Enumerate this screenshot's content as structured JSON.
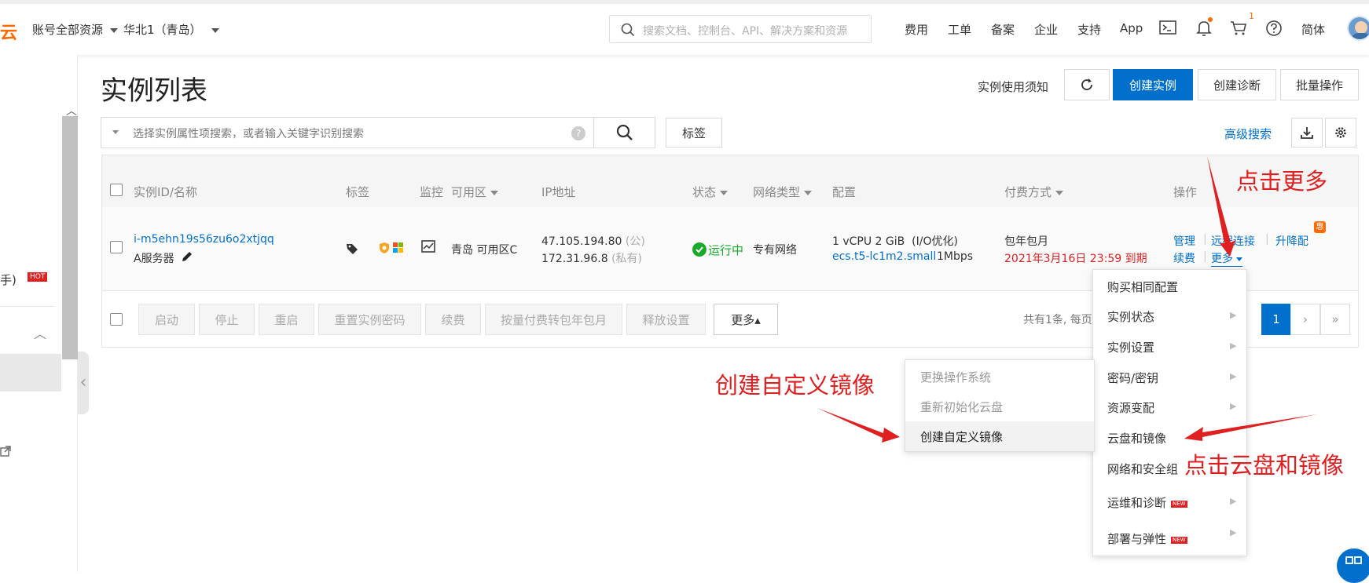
{
  "topbar": {
    "brand": "云",
    "account_scope": "账号全部资源",
    "region": "华北1（青岛）",
    "search_placeholder": "搜索文档、控制台、API、解决方案和资源",
    "nav": [
      "费用",
      "工单",
      "备案",
      "企业",
      "支持",
      "App"
    ],
    "cart_count": "1",
    "language": "简体"
  },
  "sidebar": {
    "partial_label": "手)",
    "hot_badge": "HOT"
  },
  "page": {
    "title": "实例列表",
    "usage_notice": "实例使用须知",
    "create_instance": "创建实例",
    "create_diagnosis": "创建诊断",
    "batch_ops": "批量操作",
    "filter_placeholder": "选择实例属性项搜索，或者输入关键字识别搜索",
    "tag_button": "标签",
    "advanced_search": "高级搜索"
  },
  "table": {
    "headers": {
      "id_name": "实例ID/名称",
      "tags": "标签",
      "monitor": "监控",
      "zone": "可用区",
      "ip": "IP地址",
      "status": "状态",
      "network_type": "网络类型",
      "config": "配置",
      "billing": "付费方式",
      "actions": "操作"
    },
    "row": {
      "id": "i-m5ehn19s56zu6o2xtjqq",
      "name": "A服务器",
      "zone": "青岛 可用区C",
      "public_ip": "47.105.194.80",
      "public_tag": "(公)",
      "private_ip": "172.31.96.8",
      "private_tag": "(私有)",
      "status": "运行中",
      "network": "专有网络",
      "config_line1": "1 vCPU 2 GiB",
      "config_io": "(I/O优化)",
      "instance_type": "ecs.t5-lc1m2.small",
      "bandwidth": "1Mbps",
      "billing": "包年包月",
      "expiry": "2021年3月16日 23:59 到期",
      "actions": {
        "manage": "管理",
        "remote_connect": "远程连接",
        "upgrade": "升降配",
        "renew": "续费",
        "more": "更多",
        "promo_badge": "惠"
      }
    }
  },
  "bulk_actions": [
    "启动",
    "停止",
    "重启",
    "重置实例密码",
    "续费",
    "按量付费转包年包月",
    "释放设置"
  ],
  "bulk_more": "更多▴",
  "pagination": {
    "summary": "共有1条, 每页",
    "current": "1",
    "next": "›",
    "last": "»"
  },
  "more_menu": [
    {
      "label": "购买相同配置",
      "arrow": false,
      "new": false
    },
    {
      "label": "实例状态",
      "arrow": true,
      "new": false
    },
    {
      "label": "实例设置",
      "arrow": true,
      "new": false
    },
    {
      "label": "密码/密钥",
      "arrow": true,
      "new": false
    },
    {
      "label": "资源变配",
      "arrow": true,
      "new": false
    },
    {
      "label": "云盘和镜像",
      "arrow": false,
      "new": false
    },
    {
      "label": "网络和安全组",
      "arrow": false,
      "new": false
    },
    {
      "label": "运维和诊断",
      "arrow": true,
      "new": true
    },
    {
      "label": "部署与弹性",
      "arrow": true,
      "new": true
    }
  ],
  "new_badge": "NEW",
  "submenu": [
    {
      "label": "更换操作系统",
      "disabled": true
    },
    {
      "label": "重新初始化云盘",
      "disabled": true
    },
    {
      "label": "创建自定义镜像",
      "disabled": false
    }
  ],
  "annotations": {
    "click_more": "点击更多",
    "create_image": "创建自定义镜像",
    "click_disk_image": "点击云盘和镜像"
  },
  "colors": {
    "primary": "#0070cc",
    "brand": "#ff6a00",
    "running": "#1aaa2a",
    "alert": "#e02020"
  }
}
